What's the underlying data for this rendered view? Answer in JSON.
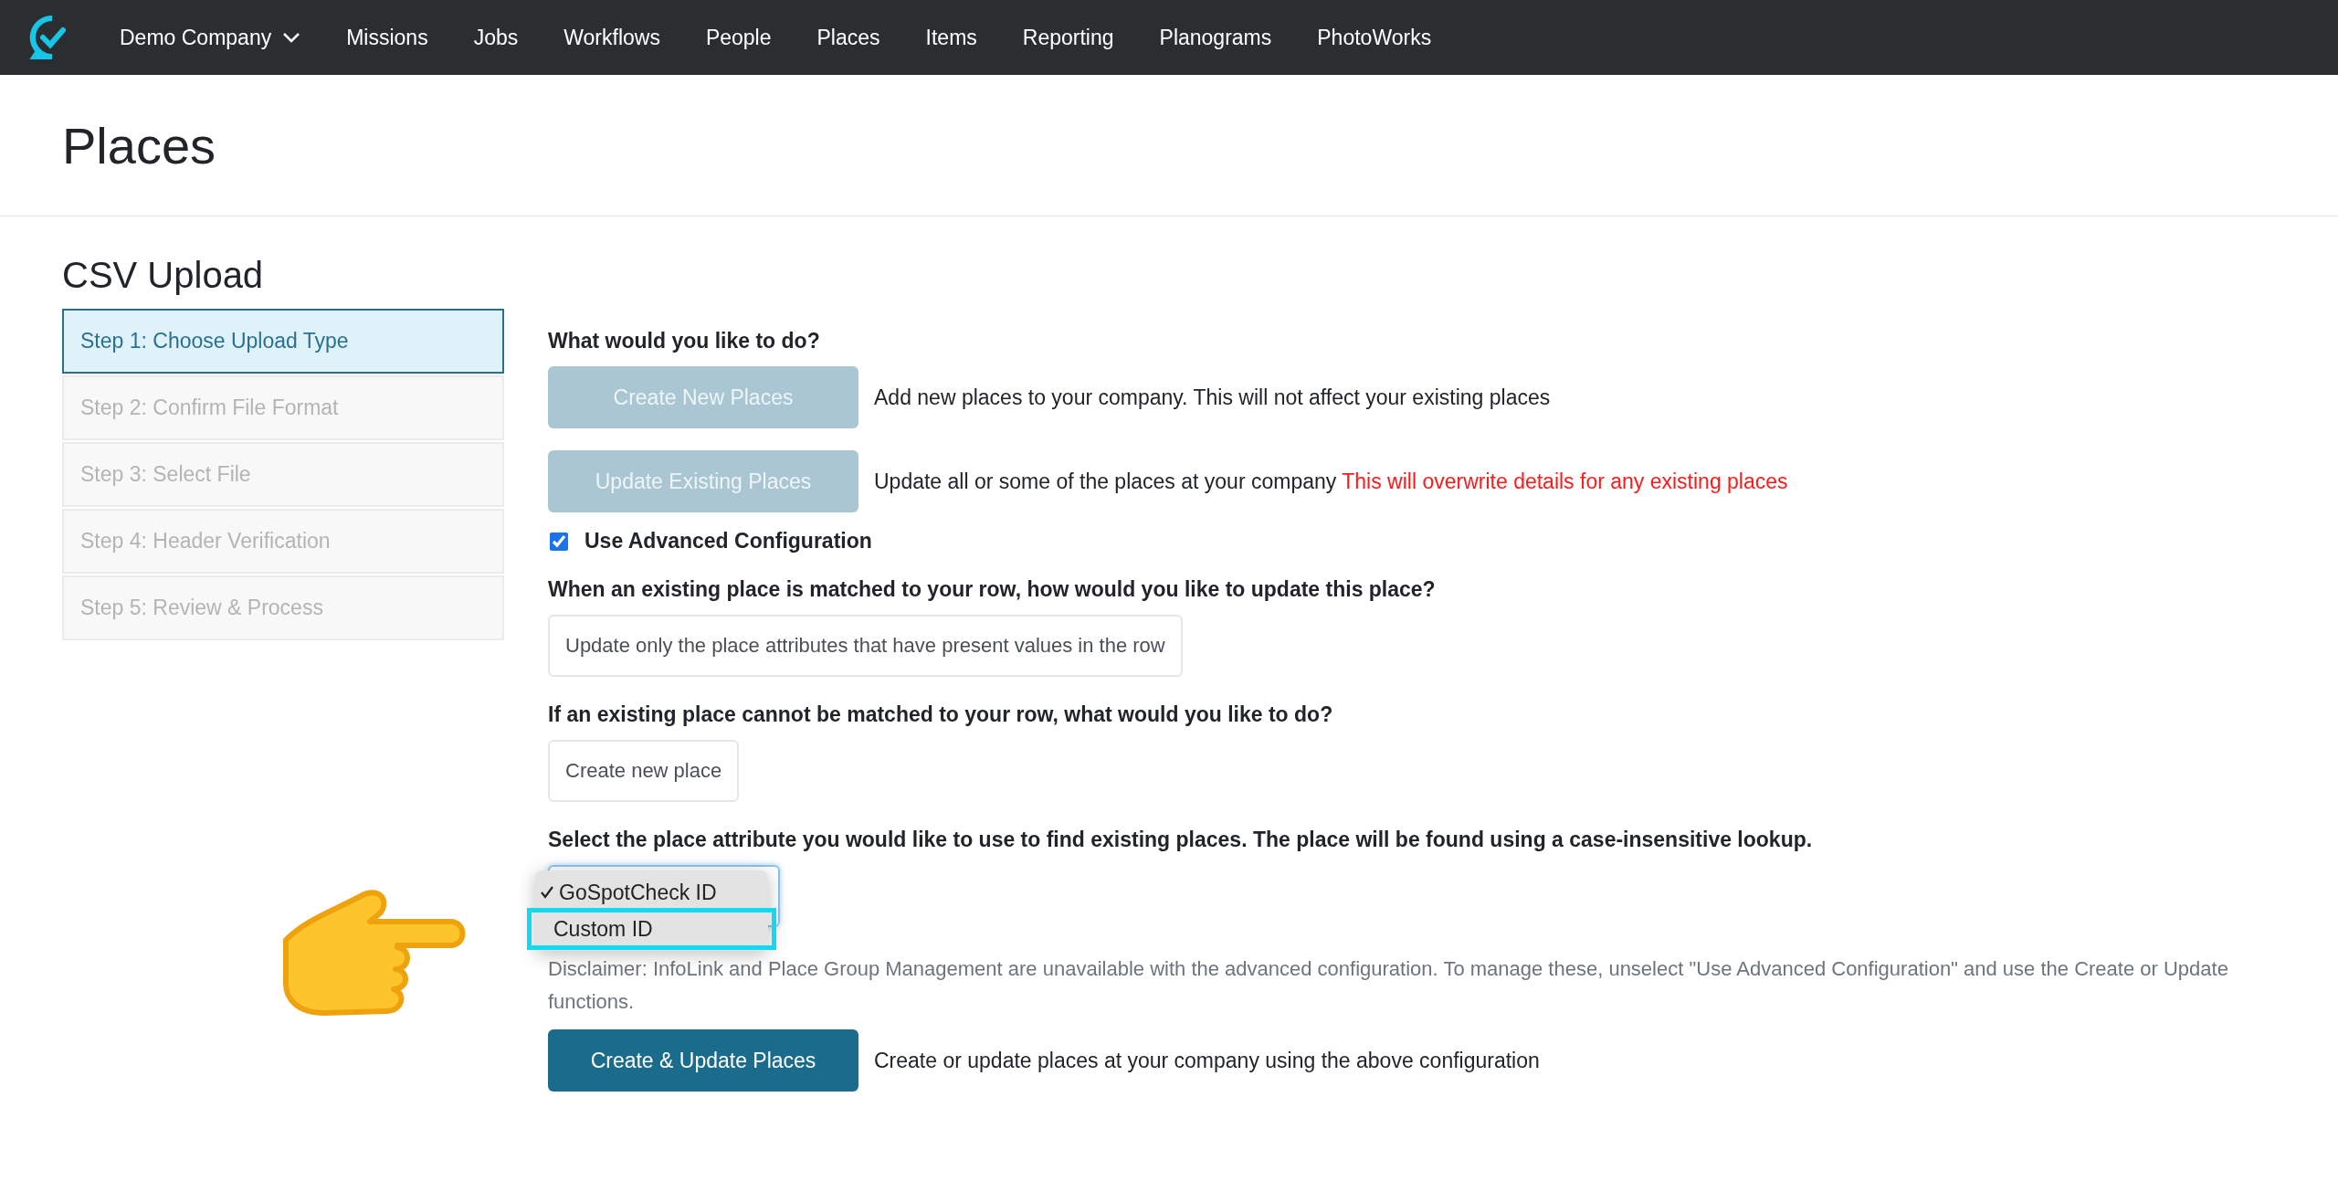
{
  "navbar": {
    "company": "Demo Company",
    "items": [
      "Missions",
      "Jobs",
      "Workflows",
      "People",
      "Places",
      "Items",
      "Reporting",
      "Planograms",
      "PhotoWorks"
    ]
  },
  "page_title": "Places",
  "section_title": "CSV Upload",
  "steps": [
    {
      "label": "Step 1: Choose Upload Type",
      "selected": true
    },
    {
      "label": "Step 2: Confirm File Format",
      "selected": false
    },
    {
      "label": "Step 3: Select File",
      "selected": false
    },
    {
      "label": "Step 4: Header Verification",
      "selected": false
    },
    {
      "label": "Step 5: Review & Process",
      "selected": false
    }
  ],
  "form": {
    "question": "What would you like to do?",
    "actions": [
      {
        "button": "Create New Places",
        "disabled": true,
        "description": "Add new places to your company. This will not affect your existing places"
      },
      {
        "button": "Update Existing Places",
        "disabled": true,
        "description": "Update all or some of the places at your company",
        "warning": "This will overwrite details for any existing places"
      }
    ],
    "advanced": {
      "label": "Use Advanced Configuration",
      "checked": true
    },
    "match_question": "When an existing place is matched to your row, how would you like to update this place?",
    "match_value": "Update only the place attributes that have present values in the row",
    "nomatch_question": "If an existing place cannot be matched to your row, what would you like to do?",
    "nomatch_value": "Create new place",
    "lookup_question": "Select the place attribute you would like to use to find existing places. The place will be found using a case-insensitive lookup.",
    "lookup_options": [
      {
        "label": "GoSpotCheck ID",
        "selected": true,
        "annotated": false
      },
      {
        "label": "Custom ID",
        "selected": false,
        "annotated": true
      }
    ],
    "disclaimer": "Disclaimer: InfoLink and Place Group Management are unavailable with the advanced configuration. To manage these, unselect \"Use Advanced Configuration\" and use the Create or Update functions.",
    "submit": {
      "button": "Create & Update Places",
      "disabled": false,
      "description": "Create or update places at your company using the above configuration"
    }
  }
}
